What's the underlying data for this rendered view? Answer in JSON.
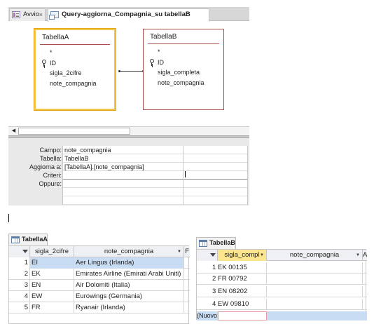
{
  "tabs": [
    {
      "label": "Avvio",
      "icon": "form-icon",
      "active": false
    },
    {
      "label": "Query-aggiorna_Compagnia_su tabellaB",
      "icon": "query-icon",
      "active": true
    }
  ],
  "tab_close": "×",
  "designer": {
    "tableA": {
      "name": "TabellaA",
      "fields": [
        "*",
        "ID",
        "sigla_2cifre",
        "note_compagnia"
      ]
    },
    "tableB": {
      "name": "TabellaB",
      "fields": [
        "*",
        "ID",
        "sigla_completa",
        "note_compagnia"
      ]
    },
    "grid_labels": [
      "Campo:",
      "Tabella:",
      "Aggiorna a:",
      "Criteri:",
      "Oppure:"
    ],
    "grid_col1": [
      "note_compagnia",
      "TabellaB",
      "[TabellaA].[note_compagnia]",
      "",
      "",
      "",
      ""
    ],
    "scroll_left_arrow": "◀"
  },
  "tabellaA": {
    "tab_label": "TabellaA",
    "columns": [
      "sigla_2cifre",
      "note_compagnia",
      "F"
    ],
    "rows": [
      {
        "num": "1",
        "sigla": "EI",
        "note": "Aer Lingus (Irlanda)"
      },
      {
        "num": "2",
        "sigla": "EK",
        "note": "Emirates Airline (Emirati Arabi Uniti)"
      },
      {
        "num": "3",
        "sigla": "EN",
        "note": "Air Dolomiti (Italia)"
      },
      {
        "num": "4",
        "sigla": "EW",
        "note": "Eurowings (Germania)"
      },
      {
        "num": "5",
        "sigla": "FR",
        "note": "Ryanair (Irlanda)"
      }
    ]
  },
  "tabellaB": {
    "tab_label": "TabellaB",
    "columns": [
      "sigla_compl",
      "note_compagnia",
      "A"
    ],
    "rows": [
      {
        "sigla": "1 EK 00135",
        "note": ""
      },
      {
        "sigla": "2 FR 00792",
        "note": ""
      },
      {
        "sigla": "3 EN 08202",
        "note": ""
      },
      {
        "sigla": "4 EW 09810",
        "note": ""
      }
    ],
    "new_row_label": "(Nuovo)"
  },
  "colors": {
    "highlight_header": "#fbe58e",
    "selected_row": "#c8ddf3",
    "relation_border": "#a94c4c",
    "selected_table_border": "#f3c645"
  }
}
